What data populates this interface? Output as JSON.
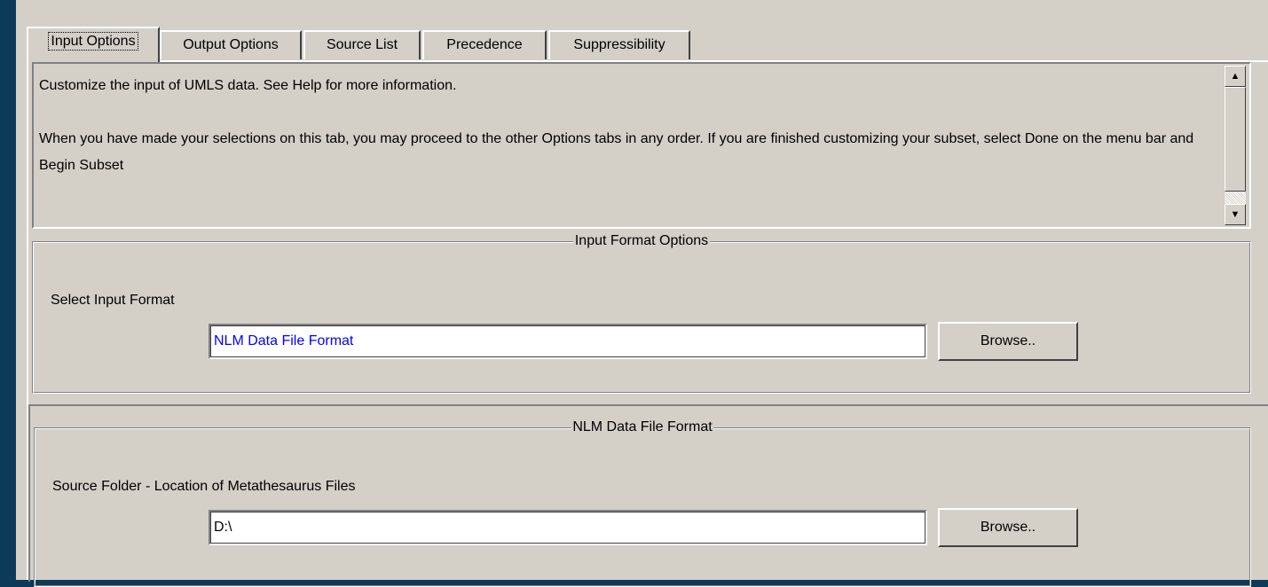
{
  "tabs": [
    {
      "label": "Input Options",
      "active": true
    },
    {
      "label": "Output Options",
      "active": false
    },
    {
      "label": "Source List",
      "active": false
    },
    {
      "label": "Precedence",
      "active": false
    },
    {
      "label": "Suppressibility",
      "active": false
    }
  ],
  "description": {
    "line1": "Customize the input of UMLS data.  See Help for more information.",
    "line2": "When you have made your selections on this tab, you may proceed to the other Options tabs in any order.  If you are finished customizing your subset, select Done on the menu bar and Begin Subset"
  },
  "scrollbar": {
    "up_icon": "triangle-up",
    "down_icon": "triangle-down"
  },
  "input_format_group": {
    "title": "Input Format Options",
    "label": "Select Input Format",
    "value": "NLM Data File Format",
    "value_color": "#0000ff",
    "browse_label": "Browse.."
  },
  "nlm_group": {
    "title": "NLM Data File Format",
    "label": "Source Folder - Location of Metathesaurus Files",
    "value": "D:\\",
    "browse_label": "Browse.."
  },
  "colors": {
    "background": "#0e3a5a",
    "dialog": "#d4d0c8",
    "annotation_arrow": "#4a9be8"
  }
}
